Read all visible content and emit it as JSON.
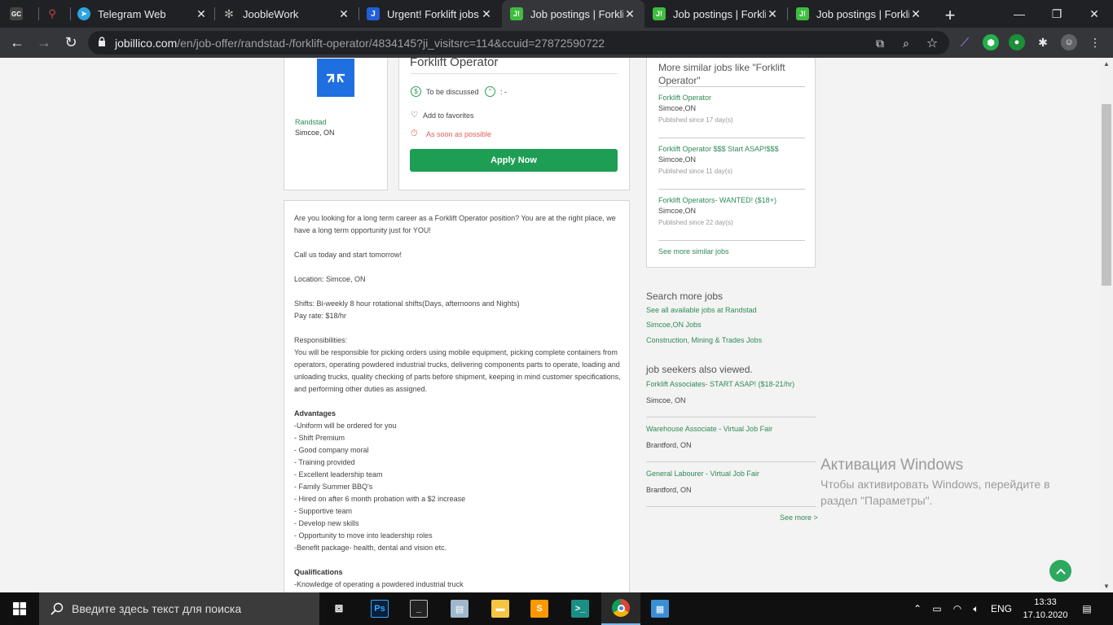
{
  "browser": {
    "tabs": [
      {
        "title": "",
        "favicon": "gc",
        "color": "#3c3c3c"
      },
      {
        "title": "",
        "favicon": "pin",
        "color": "#202124"
      },
      {
        "title": "Telegram Web",
        "favicon": "telegram",
        "color": "#2ca5e0"
      },
      {
        "title": "JoobleWork",
        "favicon": "jooble",
        "color": "#777777"
      },
      {
        "title": "Urgent! Forklift jobs",
        "favicon": "J",
        "color": "#2160d8"
      },
      {
        "title": "Job postings | Forklift",
        "favicon": "J!",
        "color": "#3fbd3f"
      },
      {
        "title": "Job postings | Forklift",
        "favicon": "J!",
        "color": "#3fbd3f"
      },
      {
        "title": "Job postings | Forklift",
        "favicon": "J!",
        "color": "#3fbd3f"
      }
    ],
    "url_host": "jobillico.com",
    "url_path": "/en/job-offer/randstad-/forklift-operator/4834145?ji_visitsrc=114&ccuid=27872590722"
  },
  "company": {
    "name": "Randstad",
    "location": "Simcoe, ON"
  },
  "job": {
    "title": "Forklift Operator",
    "salary": "To be discussed",
    "schedule": ": -",
    "favorites": "Add to favorites",
    "start": "As soon as possible",
    "apply_label": "Apply Now"
  },
  "description": {
    "intro": "Are you looking for a long term career as a Forklift Operator position? You are at the right place, we have a long term opportunity just for YOU!",
    "call": "Call us today and start tomorrow!",
    "location": "Location: Simcoe, ON",
    "shifts": "Shifts: Bi-weekly 8 hour rotational shifts(Days, afternoons and Nights)",
    "pay": "Pay rate: $18/hr",
    "resp_heading": "Responsibilities:",
    "resp_text": "You will be responsible for picking orders using mobile equipment, picking complete containers from operators, operating powdered industrial trucks, delivering components parts to operate, loading and unloading trucks, quality checking of parts before shipment, keeping in mind customer specifications, and performing other duties as assigned.",
    "adv_heading": "Advantages",
    "advantages": [
      "-Uniform will be ordered for you",
      "- Shift Premium",
      "- Good company moral",
      "- Training provided",
      "- Excellent leadership team",
      "- Family Summer BBQ's",
      "- Hired on after 6 month probation with a $2 increase",
      "- Supportive team",
      "- Develop new skills",
      "- Opportunity to move into leadership roles",
      "-Benefit package- health, dental and vision etc."
    ],
    "qual_heading": "Qualifications",
    "qual_first": "-Knowledge of operating a powdered industrial truck"
  },
  "similar": {
    "heading": "More similar jobs like \"Forklift Operator\"",
    "items": [
      {
        "title": "Forklift Operator",
        "location": "Simcoe,ON",
        "published": "Published since 17 day(s)"
      },
      {
        "title": "Forklift Operator $$$ Start ASAP!$$$",
        "location": "Simcoe,ON",
        "published": "Published since 11 day(s)"
      },
      {
        "title": "Forklift Operators- WANTED! ($18+)",
        "location": "Simcoe,ON",
        "published": "Published since 22 day(s)"
      }
    ],
    "more": "See more similar jobs"
  },
  "search_more": {
    "heading": "Search more jobs",
    "links": [
      "See all available jobs at Randstad",
      "Simcoe,ON Jobs",
      "Construction, Mining & Trades Jobs"
    ]
  },
  "also_viewed": {
    "heading": "job seekers also viewed.",
    "items": [
      {
        "title": "Forklift Associates- START ASAP! ($18-21/hr)",
        "location": "Simcoe, ON"
      },
      {
        "title": "Warehouse Associate - Virtual Job Fair",
        "location": "Brantford, ON"
      },
      {
        "title": "General Labourer - Virtual Job Fair",
        "location": "Brantford, ON"
      }
    ],
    "more": "See more >"
  },
  "watermark": {
    "title": "Активация Windows",
    "line1": "Чтобы активировать Windows, перейдите в",
    "line2": "раздел \"Параметры\"."
  },
  "taskbar": {
    "search_placeholder": "Введите здесь текст для поиска",
    "lang": "ENG",
    "time": "13:33",
    "date": "17.10.2020"
  }
}
